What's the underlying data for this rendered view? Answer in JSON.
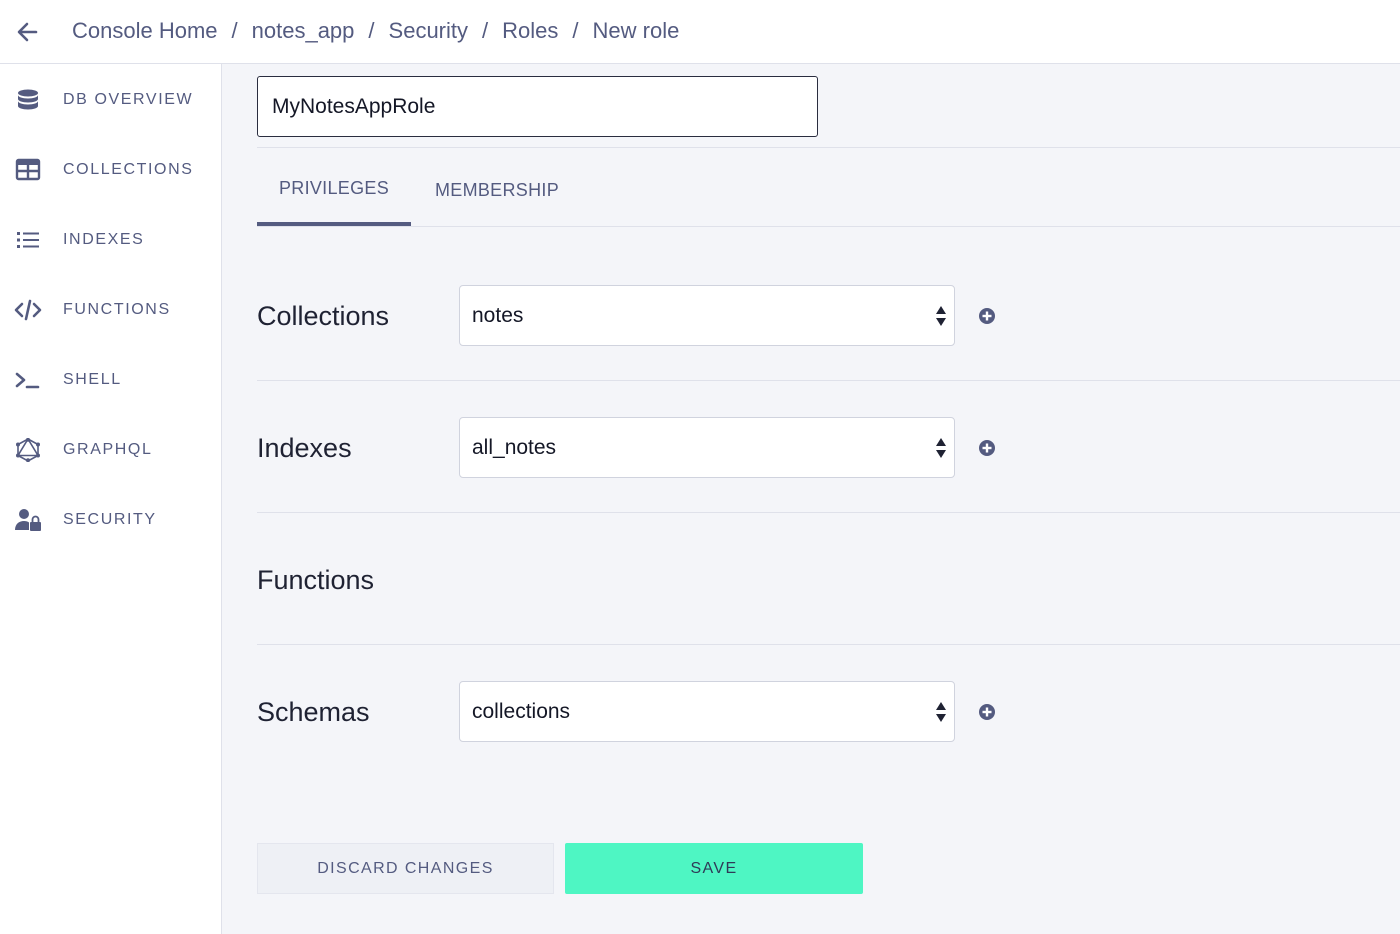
{
  "breadcrumb": {
    "items": [
      "Console Home",
      "notes_app",
      "Security",
      "Roles",
      "New role"
    ],
    "separator": "/"
  },
  "sidebar": {
    "items": [
      {
        "label": "DB OVERVIEW",
        "icon": "database-icon"
      },
      {
        "label": "COLLECTIONS",
        "icon": "table-icon"
      },
      {
        "label": "INDEXES",
        "icon": "list-icon"
      },
      {
        "label": "FUNCTIONS",
        "icon": "code-icon"
      },
      {
        "label": "SHELL",
        "icon": "terminal-icon"
      },
      {
        "label": "GRAPHQL",
        "icon": "graphql-icon"
      },
      {
        "label": "SECURITY",
        "icon": "user-lock-icon"
      }
    ]
  },
  "role": {
    "name": "MyNotesAppRole"
  },
  "tabs": [
    {
      "label": "PRIVILEGES",
      "active": true
    },
    {
      "label": "MEMBERSHIP",
      "active": false
    }
  ],
  "privileges": {
    "collections": {
      "label": "Collections",
      "selected": "notes"
    },
    "indexes": {
      "label": "Indexes",
      "selected": "all_notes"
    },
    "functions": {
      "label": "Functions"
    },
    "schemas": {
      "label": "Schemas",
      "selected": "collections"
    }
  },
  "actions": {
    "discard_label": "DISCARD CHANGES",
    "save_label": "SAVE"
  },
  "colors": {
    "accent": "#545b80",
    "save": "#4ef6c3",
    "background": "#f4f5f9"
  }
}
